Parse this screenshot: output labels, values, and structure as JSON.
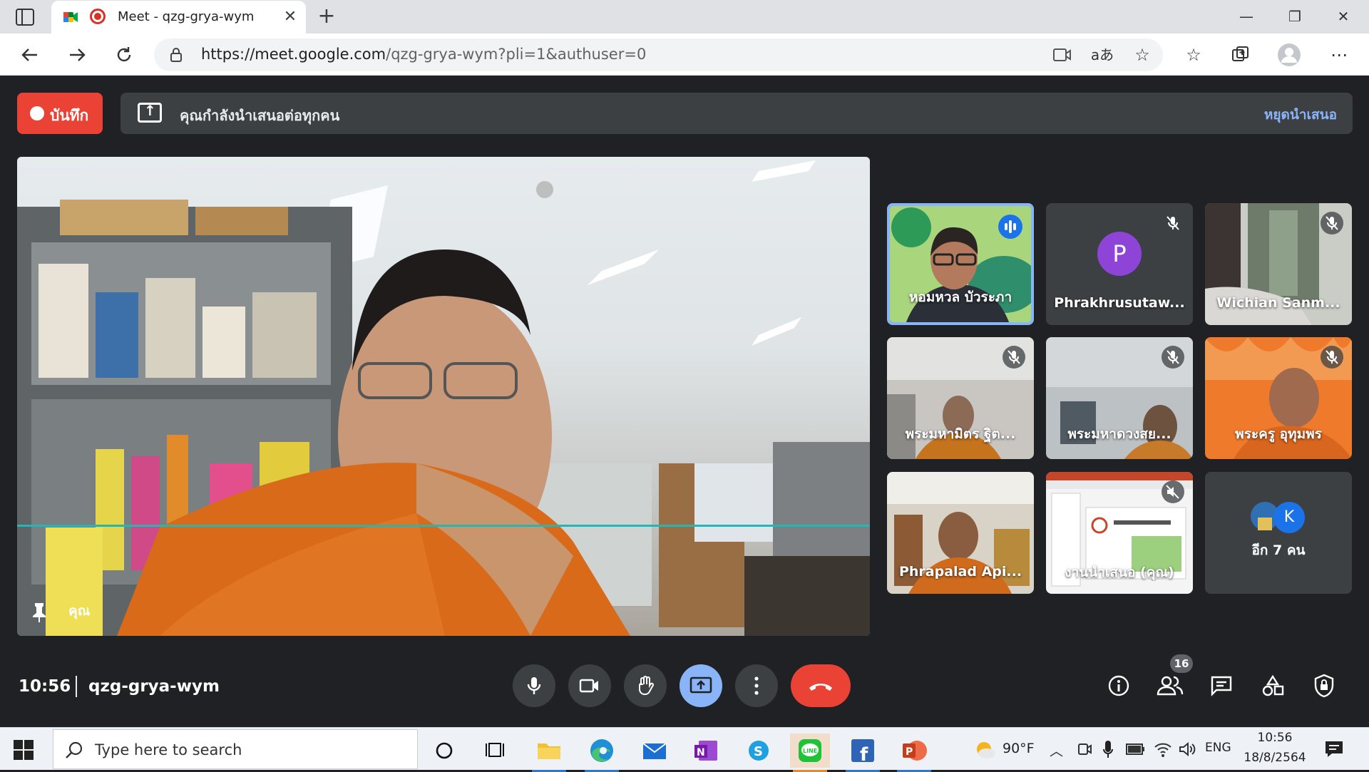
{
  "browser": {
    "tab_title": "Meet - qzg-grya-wym",
    "url_host": "https://meet.google.com",
    "url_path": "/qzg-grya-wym?pli=1&authuser=0"
  },
  "meet": {
    "record_label": "บันทึก",
    "presenting_text": "คุณกำลังนำเสนอต่อทุกคน",
    "stop_presenting_label": "หยุดนำเสนอ",
    "self_label": "คุณ",
    "time": "10:56",
    "meeting_code": "qzg-grya-wym",
    "people_count": "16",
    "tiles": [
      {
        "name": "หอมหวล บัวระภา",
        "avatar": ""
      },
      {
        "name": "Phrakhrusutaw...",
        "avatar": "P"
      },
      {
        "name": "Wichian Sanm..."
      },
      {
        "name": "พระมหามิตร ฐิต..."
      },
      {
        "name": "พระมหาดวงสย..."
      },
      {
        "name": "พระครู อุทุมพร"
      },
      {
        "name": "Phrapalad Api..."
      },
      {
        "name": "งานนำเสนอ (คุณ)"
      },
      {
        "name": "อีก 7 คน",
        "avatar": "K"
      }
    ],
    "colors": {
      "record": "#ea4335",
      "accent": "#8ab4f8",
      "avatar_p": "#8e44d6",
      "avatar_k": "#1a73e8"
    }
  },
  "taskbar": {
    "search_placeholder": "Type here to search",
    "weather": "90°F",
    "language": "ENG",
    "time": "10:56",
    "date": "18/8/2564"
  }
}
